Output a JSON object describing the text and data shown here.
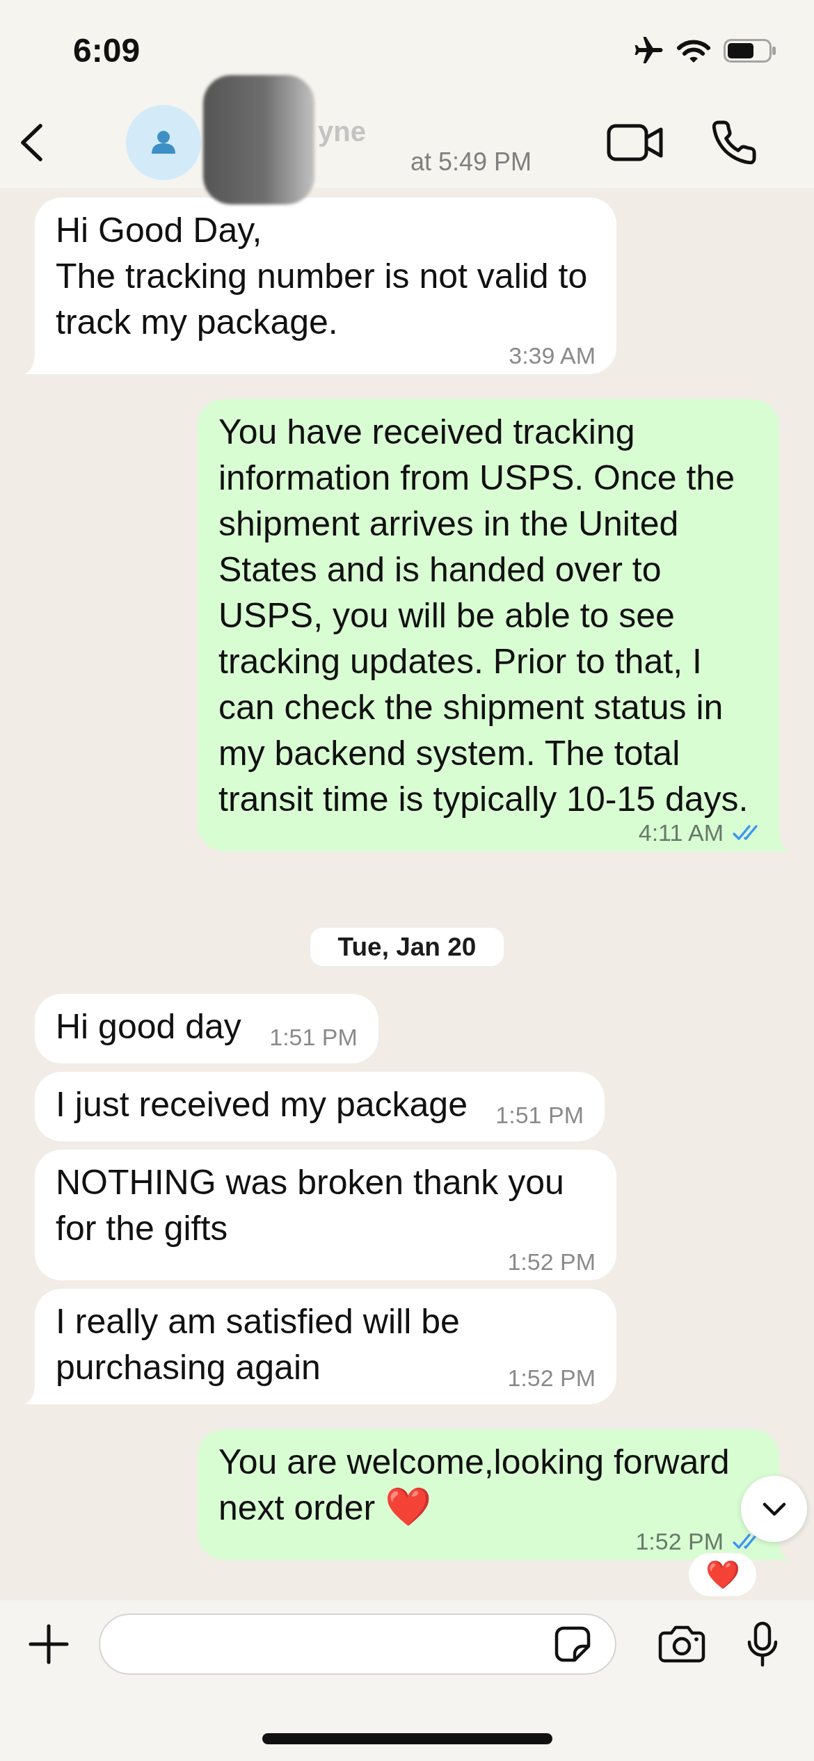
{
  "status_bar": {
    "time": "6:09"
  },
  "header": {
    "name": "yne",
    "status": "at 5:49 PM",
    "redacted": true
  },
  "chat": {
    "items": [
      {
        "kind": "incoming",
        "text": "Hi Good Day,\nThe tracking number is not valid to track my package.",
        "time": "3:39 AM",
        "tail": true
      },
      {
        "kind": "outgoing",
        "text": "You have received tracking information from USPS. Once the shipment arrives in the United States and is handed over to USPS, you will be able to see tracking updates. Prior to that, I can check the shipment status in my backend system. The total transit time is typically 10-15 days.",
        "time": "4:11 AM",
        "tail": true,
        "read": true
      },
      {
        "kind": "date",
        "text": "Tue, Jan 20"
      },
      {
        "kind": "incoming",
        "text": "Hi good day",
        "time": "1:51 PM",
        "tail": false
      },
      {
        "kind": "incoming",
        "text": "I just received my package",
        "time": "1:51 PM",
        "tail": false
      },
      {
        "kind": "incoming",
        "text": "NOTHING was broken thank you for the gifts",
        "time": "1:52 PM",
        "tail": false
      },
      {
        "kind": "incoming",
        "text": "I really am satisfied will be purchasing again",
        "time": "1:52 PM",
        "tail": true
      },
      {
        "kind": "outgoing",
        "text": "You are welcome,looking forward next order",
        "emoji": "❤️",
        "time": "1:52 PM",
        "tail": true,
        "read": true,
        "reaction": "❤️"
      }
    ]
  }
}
